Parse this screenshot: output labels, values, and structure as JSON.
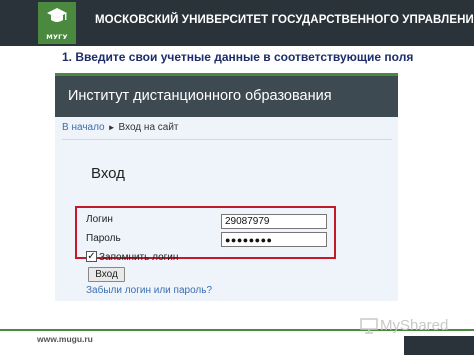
{
  "header": {
    "logo_text": "МУГУ",
    "university_name": "МОСКОВСКИЙ УНИВЕРСИТЕТ ГОСУДАРСТВЕННОГО УПРАВЛЕНИЯ"
  },
  "instruction": "1. Введите свои учетные данные в соответствующие поля",
  "screenshot": {
    "site_title": "Институт дистанционного образования",
    "breadcrumb": {
      "home": "В начало",
      "separator": "►",
      "current": "Вход на сайт"
    },
    "login_heading": "Вход",
    "form": {
      "username_label": "Логин",
      "username_value": "29087979",
      "password_label": "Пароль",
      "password_value": "●●●●●●●●",
      "remember_checked": true,
      "remember_label": "Запомнить логин",
      "submit_label": "Вход",
      "forgot_link": "Забыли логин или пароль?"
    }
  },
  "footer": {
    "url": "www.mugu.ru",
    "watermark": "MyShared"
  },
  "colors": {
    "header_bg": "#2a333a",
    "brand_green": "#4b8a3e",
    "instruction_text": "#1e2d6b",
    "highlight_red": "#c4182b",
    "link_blue": "#3a6eb2"
  },
  "icons": {
    "logo": "graduation-cap-icon",
    "watermark": "presentation-board-icon"
  }
}
